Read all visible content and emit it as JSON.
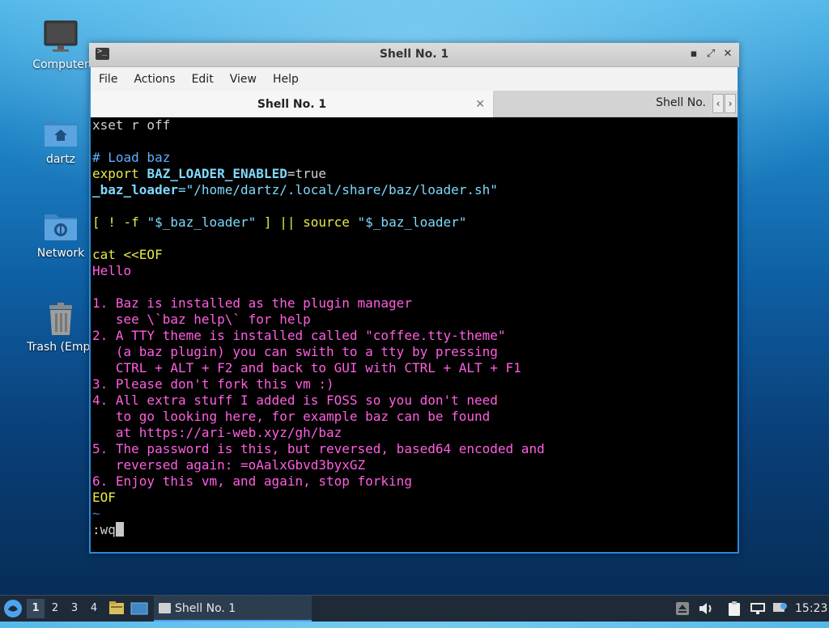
{
  "desktop": {
    "icons": [
      {
        "label": "Computer",
        "icon": "monitor-icon"
      },
      {
        "label": "dartz",
        "icon": "home-folder-icon"
      },
      {
        "label": "Network",
        "icon": "network-folder-icon"
      },
      {
        "label": "Trash (Empt",
        "icon": "trash-icon"
      }
    ]
  },
  "window": {
    "title": "Shell No. 1",
    "controls": {
      "minimize": "▪",
      "maximize": "⤢",
      "close": "✕"
    },
    "menu": [
      "File",
      "Actions",
      "Edit",
      "View",
      "Help"
    ],
    "tabs": [
      {
        "label": "Shell No. 1",
        "active": true,
        "close": "✕"
      },
      {
        "label": "Shell No.",
        "active": false
      }
    ],
    "tab_arrows": {
      "left": "‹",
      "right": "›"
    }
  },
  "terminal": {
    "lines": [
      [
        {
          "t": "xset r off",
          "c": "default"
        }
      ],
      [],
      [
        {
          "t": "# Load baz",
          "c": "comment"
        }
      ],
      [
        {
          "t": "export ",
          "c": "keyword"
        },
        {
          "t": "BAZ_LOADER_ENABLED",
          "c": "var"
        },
        {
          "t": "=true",
          "c": "default"
        }
      ],
      [
        {
          "t": "_baz_loader",
          "c": "var"
        },
        {
          "t": "=\"/home/dartz/.local/share/baz/loader.sh\"",
          "c": "string"
        }
      ],
      [],
      [
        {
          "t": "[ ! -f ",
          "c": "keyword"
        },
        {
          "t": "\"$_baz_loader\"",
          "c": "string"
        },
        {
          "t": " ] || ",
          "c": "keyword"
        },
        {
          "t": "source ",
          "c": "keyword"
        },
        {
          "t": "\"$_baz_loader\"",
          "c": "string"
        }
      ],
      [],
      [
        {
          "t": "cat <<EOF",
          "c": "keyword"
        }
      ],
      [
        {
          "t": "Hello",
          "c": "heredoc"
        }
      ],
      [],
      [
        {
          "t": "1. Baz is installed as the plugin manager",
          "c": "heredoc"
        }
      ],
      [
        {
          "t": "   see \\`baz help\\` for help",
          "c": "heredoc"
        }
      ],
      [
        {
          "t": "2. A TTY theme is installed called \"coffee.tty-theme\"",
          "c": "heredoc"
        }
      ],
      [
        {
          "t": "   (a baz plugin) you can swith to a tty by pressing",
          "c": "heredoc"
        }
      ],
      [
        {
          "t": "   CTRL + ALT + F2 and back to GUI with CTRL + ALT + F1",
          "c": "heredoc"
        }
      ],
      [
        {
          "t": "3. Please don't fork this vm :)",
          "c": "heredoc"
        }
      ],
      [
        {
          "t": "4. All extra stuff I added is FOSS so you don't need",
          "c": "heredoc"
        }
      ],
      [
        {
          "t": "   to go looking here, for example baz can be found",
          "c": "heredoc"
        }
      ],
      [
        {
          "t": "   at https://ari-web.xyz/gh/baz",
          "c": "heredoc"
        }
      ],
      [
        {
          "t": "5. The password is this, but reversed, based64 encoded and",
          "c": "heredoc"
        }
      ],
      [
        {
          "t": "   reversed again: =oAalxGbvd3byxGZ",
          "c": "heredoc"
        }
      ],
      [
        {
          "t": "6. Enjoy this vm, and again, stop forking",
          "c": "heredoc"
        }
      ],
      [
        {
          "t": "EOF",
          "c": "keyword"
        }
      ],
      [
        {
          "t": "~",
          "c": "tilde"
        }
      ]
    ],
    "command_line": ":wq"
  },
  "taskbar": {
    "start_icon": "lxqt-start-icon",
    "workspaces": [
      "1",
      "2",
      "3",
      "4"
    ],
    "active_workspace": "1",
    "quicklaunch": [
      "file-manager-icon",
      "show-desktop-icon"
    ],
    "task": {
      "label": "Shell No. 1",
      "icon": "terminal-icon"
    },
    "tray": [
      "eject-icon",
      "volume-icon",
      "clipboard-icon",
      "network-wired-icon",
      "update-notifier-icon"
    ],
    "clock": "15:23"
  },
  "colors": {
    "accent": "#4ea3f0",
    "heredoc": "#ff5fe0",
    "keyword": "#e8e84a",
    "string": "#7fd9ff"
  }
}
